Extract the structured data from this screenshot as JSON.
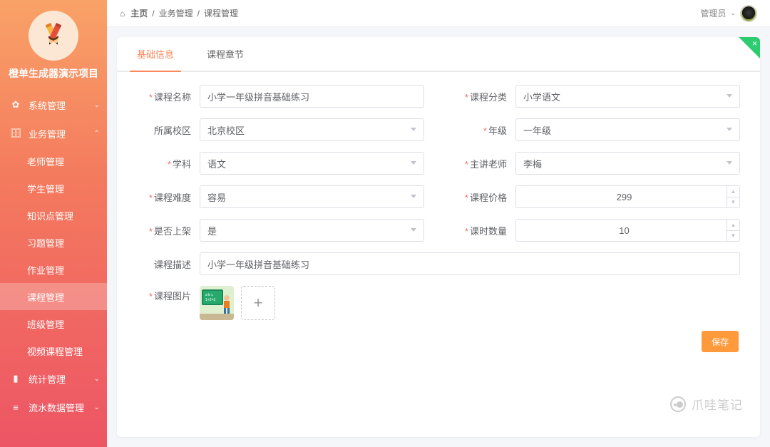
{
  "app": {
    "name": "橙单生成器演示项目"
  },
  "header": {
    "breadcrumb": {
      "home": "主页",
      "l1": "业务管理",
      "l2": "课程管理"
    },
    "admin_label": "管理员"
  },
  "sidebar": {
    "items": [
      {
        "id": "system",
        "label": "系统管理",
        "type": "group",
        "icon": "gear"
      },
      {
        "id": "biz",
        "label": "业务管理",
        "type": "group",
        "icon": "briefcase",
        "expanded": true
      },
      {
        "id": "teacher",
        "label": "老师管理",
        "type": "sub"
      },
      {
        "id": "student",
        "label": "学生管理",
        "type": "sub"
      },
      {
        "id": "knowledge",
        "label": "知识点管理",
        "type": "sub"
      },
      {
        "id": "exercise",
        "label": "习题管理",
        "type": "sub"
      },
      {
        "id": "homework",
        "label": "作业管理",
        "type": "sub"
      },
      {
        "id": "course",
        "label": "课程管理",
        "type": "sub",
        "active": true
      },
      {
        "id": "class",
        "label": "班级管理",
        "type": "sub"
      },
      {
        "id": "video",
        "label": "视频课程管理",
        "type": "sub"
      },
      {
        "id": "stats",
        "label": "统计管理",
        "type": "group",
        "icon": "bar-chart"
      },
      {
        "id": "flow",
        "label": "流水数据管理",
        "type": "group",
        "icon": "flow"
      }
    ]
  },
  "tabs": {
    "t1": "基础信息",
    "t2": "课程章节"
  },
  "form": {
    "labels": {
      "course_name": "课程名称",
      "course_category": "课程分类",
      "campus": "所属校区",
      "grade": "年级",
      "subject": "学科",
      "teacher": "主讲老师",
      "difficulty": "课程难度",
      "price": "课程价格",
      "on_shelf": "是否上架",
      "lesson_count": "课时数量",
      "description": "课程描述",
      "image": "课程图片"
    },
    "values": {
      "course_name": "小学一年级拼音基础练习",
      "course_category": "小学语文",
      "campus": "北京校区",
      "grade": "一年级",
      "subject": "语文",
      "teacher": "李梅",
      "difficulty": "容易",
      "price": "299",
      "on_shelf": "是",
      "lesson_count": "10",
      "description": "小学一年级拼音基础练习"
    }
  },
  "buttons": {
    "save": "保存"
  },
  "watermark": "爪哇笔记"
}
